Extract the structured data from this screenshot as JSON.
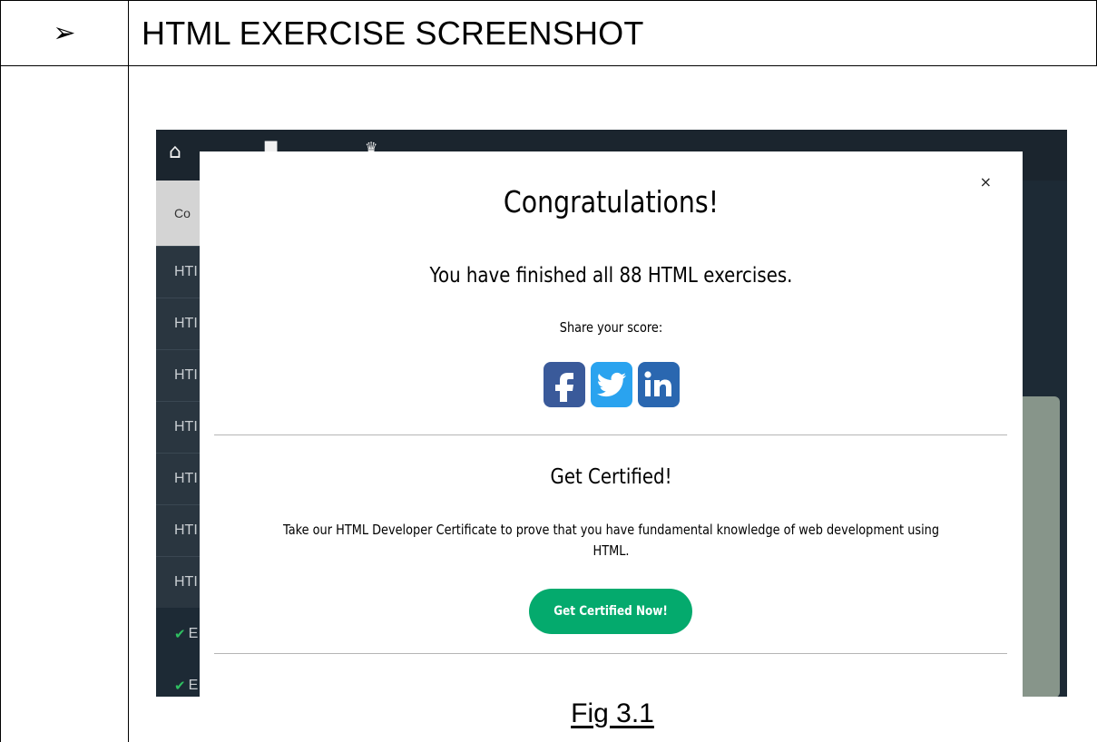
{
  "document": {
    "bullet_symbol": "➢",
    "heading": "HTML EXERCISE SCREENSHOT",
    "caption": "Fig 3.1"
  },
  "app": {
    "topbar_icons": [
      "home-icon",
      "bucket-icon",
      "crown-icon"
    ],
    "sidebar": {
      "current_label": "Co",
      "items": [
        "HTI",
        "HTI",
        "HTI",
        "HTI",
        "HTI",
        "HTI",
        "HTI"
      ],
      "completed_items": [
        "E",
        "E"
      ]
    }
  },
  "modal": {
    "close_symbol": "×",
    "title": "Congratulations!",
    "finished_text": "You have finished all 88 HTML exercises.",
    "share_label": "Share your score:",
    "share_icons": [
      {
        "name": "facebook-icon",
        "glyph": "f",
        "color": "#3a5a9a"
      },
      {
        "name": "twitter-icon",
        "glyph": "",
        "color": "#2aa3ef"
      },
      {
        "name": "linkedin-icon",
        "glyph": "in",
        "color": "#2a67b0"
      }
    ],
    "cert_title": "Get Certified!",
    "cert_text": "Take our HTML Developer Certificate to prove that you have fundamental knowledge of web development using HTML.",
    "cert_button": "Get Certified Now!"
  },
  "colors": {
    "app_background": "#1d2a35",
    "accent_green": "#04aa6d",
    "check_green": "#2fbf61",
    "side_panel": "#87958a"
  }
}
